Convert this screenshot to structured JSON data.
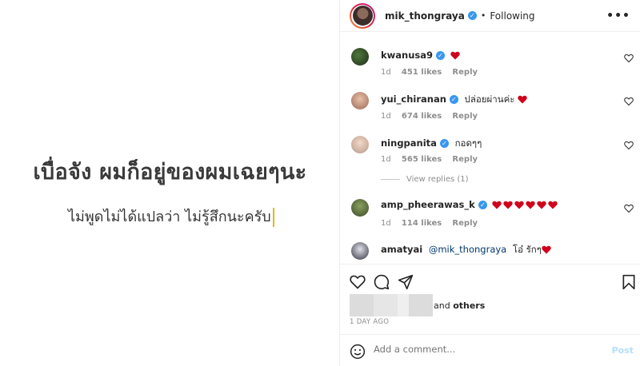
{
  "post_media": {
    "headline": "เบื่อจัง ผมก็อยู่ของผมเฉยๆนะ",
    "subline": "ไม่พูดไม่ได้แปลว่า ไม่รู้สึกนะครับ"
  },
  "header": {
    "username": "mik_thongraya",
    "separator": "•",
    "follow_status": "Following",
    "more": "•••"
  },
  "comments": [
    {
      "username": "kwanusa9",
      "text": "",
      "age": "1d",
      "likes": "451 likes",
      "reply": "Reply"
    },
    {
      "username": "yui_chiranan",
      "text": "ปล่อยผ่านค่ะ",
      "age": "1d",
      "likes": "674 likes",
      "reply": "Reply"
    },
    {
      "username": "ningpanita",
      "text": "กอดๆๆ",
      "age": "1d",
      "likes": "565 likes",
      "reply": "Reply"
    },
    {
      "username": "amp_pheerawas_k",
      "text": "",
      "age": "1d",
      "likes": "114 likes",
      "reply": "Reply"
    },
    {
      "username": "amatyai",
      "mention": "@mik_thongraya",
      "text": "โอ๋ รักๆ"
    }
  ],
  "view_replies": "View replies (1)",
  "likes_summary": {
    "prefix": "and",
    "others": "others"
  },
  "timestamp": "1 DAY AGO",
  "add_comment": {
    "placeholder": "Add a comment...",
    "post_label": "Post"
  },
  "colors": {
    "verified": "#3897f0",
    "heart": "#ed4956",
    "post_disabled": "#b2dffc",
    "cursor": "#e6b800"
  },
  "icons": [
    "heart-icon",
    "comment-icon",
    "share-icon",
    "bookmark-icon",
    "emoji-icon",
    "verified-icon",
    "more-icon"
  ]
}
